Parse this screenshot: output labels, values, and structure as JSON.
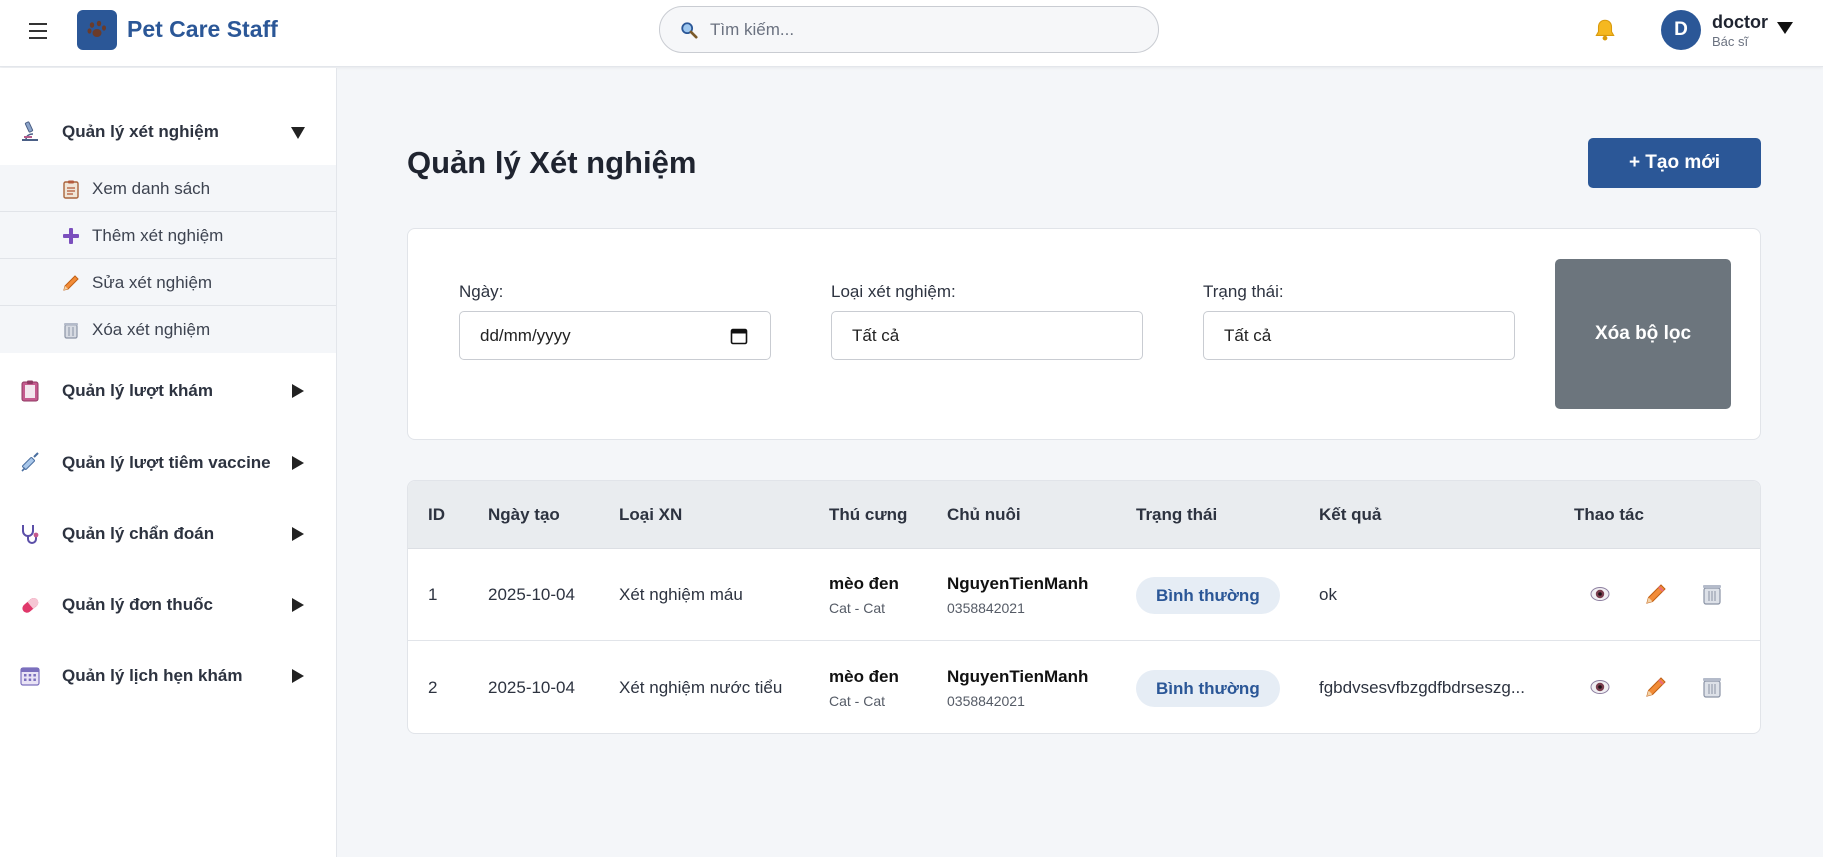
{
  "header": {
    "brand": "Pet Care Staff",
    "search_placeholder": "Tìm kiếm...",
    "user": {
      "initial": "D",
      "name": "doctor",
      "role": "Bác sĩ"
    }
  },
  "sidebar": {
    "items": [
      {
        "label": "Quản lý xét nghiệm",
        "icon": "microscope-icon",
        "expanded": true
      },
      {
        "label": "Quản lý lượt khám",
        "icon": "clipboard-icon"
      },
      {
        "label": "Quản lý lượt tiêm vaccine",
        "icon": "syringe-icon"
      },
      {
        "label": "Quản lý chẩn đoán",
        "icon": "stethoscope-icon"
      },
      {
        "label": "Quản lý đơn thuốc",
        "icon": "pill-icon"
      },
      {
        "label": "Quản lý lịch hẹn khám",
        "icon": "calendar-icon"
      }
    ],
    "subitems": [
      {
        "label": "Xem danh sách",
        "icon": "clipboard-list-icon"
      },
      {
        "label": "Thêm xét nghiệm",
        "icon": "plus-icon"
      },
      {
        "label": "Sửa xét nghiệm",
        "icon": "pencil-icon"
      },
      {
        "label": "Xóa xét nghiệm",
        "icon": "trash-icon"
      }
    ]
  },
  "main": {
    "title": "Quản lý Xét nghiệm",
    "create_label": "+ Tạo mới",
    "filters": {
      "date_label": "Ngày:",
      "date_value": "dd/mm/yyyy",
      "type_label": "Loại xét nghiệm:",
      "type_value": "Tất cả",
      "status_label": "Trạng thái:",
      "status_value": "Tất cả",
      "clear_label": "Xóa bộ lọc"
    },
    "table": {
      "headers": [
        "ID",
        "Ngày tạo",
        "Loại XN",
        "Thú cưng",
        "Chủ nuôi",
        "Trạng thái",
        "Kết quả",
        "Thao tác"
      ],
      "rows": [
        {
          "id": "1",
          "date": "2025-10-04",
          "type": "Xét nghiệm máu",
          "pet": "mèo đen",
          "pet_species": "Cat - Cat",
          "owner": "NguyenTienManh",
          "phone": "0358842021",
          "status": "Bình thường",
          "result": "ok"
        },
        {
          "id": "2",
          "date": "2025-10-04",
          "type": "Xét nghiệm nước tiểu",
          "pet": "mèo đen",
          "pet_species": "Cat - Cat",
          "owner": "NguyenTienManh",
          "phone": "0358842021",
          "status": "Bình thường",
          "result": "fgbdvsesvfbzgdfbdrseszg..."
        }
      ]
    }
  },
  "colors": {
    "primary": "#2b5797",
    "clear_button": "#6c757d",
    "badge_bg": "#e6edf5"
  }
}
